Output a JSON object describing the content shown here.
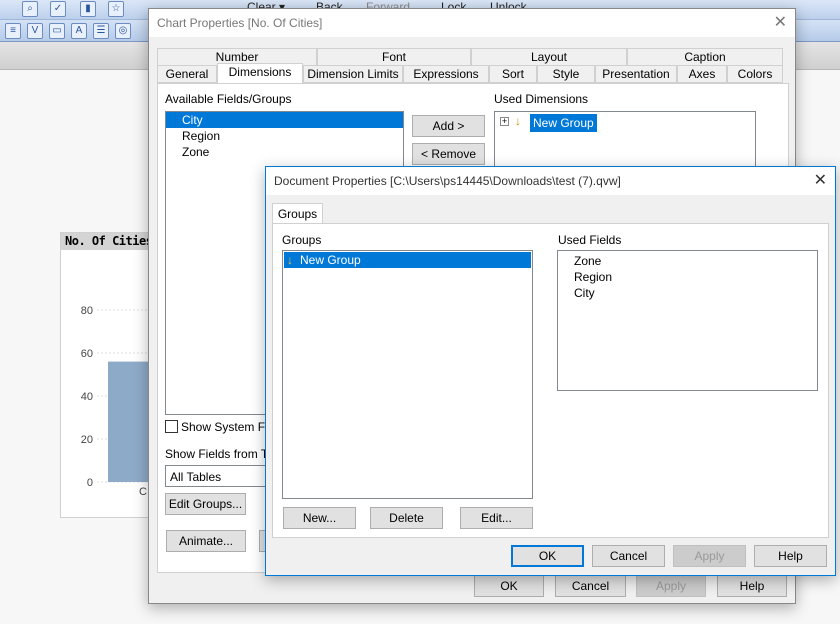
{
  "toolbar": {
    "clear": "Clear ▾",
    "back": "Back",
    "forward": "Forward",
    "lock": "Lock",
    "unlock": "Unlock"
  },
  "chart": {
    "title": "No. Of  Cities",
    "chart_data": {
      "type": "bar",
      "title": "No. Of  Cities",
      "categories": [
        "C"
      ],
      "values": [
        56
      ],
      "ylim": [
        0,
        90
      ],
      "yticks": [
        "0",
        "20",
        "40",
        "60",
        "80"
      ],
      "grid": true,
      "bar_color": "#8eaac9"
    }
  },
  "chart_props": {
    "title": "Chart Properties [No. Of  Cities]",
    "tabs_row1": [
      "Number",
      "Font",
      "Layout",
      "Caption"
    ],
    "tabs_row2": [
      "General",
      "Dimensions",
      "Dimension Limits",
      "Expressions",
      "Sort",
      "Style",
      "Presentation",
      "Axes",
      "Colors"
    ],
    "available_label": "Available Fields/Groups",
    "available": [
      "City",
      "Region",
      "Zone"
    ],
    "add": "Add >",
    "remove": "< Remove",
    "used_label": "Used Dimensions",
    "used": "New Group",
    "show_system": "Show System Fields",
    "show_from": "Show Fields from Table",
    "table_select": "All Tables",
    "edit_groups": "Edit Groups...",
    "animate": "Animate...",
    "ok": "OK",
    "cancel": "Cancel",
    "apply": "Apply",
    "help": "Help"
  },
  "doc_props": {
    "title": "Document Properties [C:\\Users\\ps14445\\Downloads\\test (7).qvw]",
    "tab": "Groups",
    "groups_label": "Groups",
    "groups": [
      "New Group"
    ],
    "used_label": "Used Fields",
    "used_fields": [
      "Zone",
      "Region",
      "City"
    ],
    "new": "New...",
    "delete": "Delete",
    "edit": "Edit...",
    "ok": "OK",
    "cancel": "Cancel",
    "apply": "Apply",
    "help": "Help"
  },
  "colors": {
    "selection": "#0078d7",
    "accent": "#0078d7"
  }
}
